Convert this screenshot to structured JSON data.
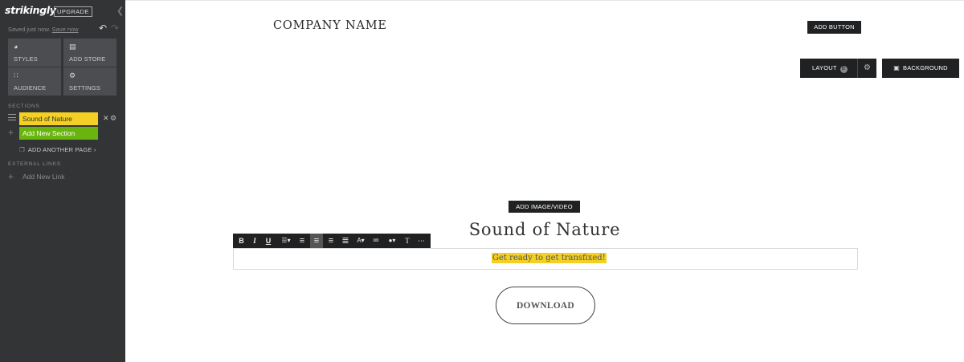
{
  "sidebar": {
    "logo": "strikingly",
    "upgrade": "UPGRADE",
    "saved_text": "Saved just now.",
    "save_now": "Save now",
    "tiles": [
      {
        "label": "STYLES",
        "icon": "palette-icon",
        "glyph": "◕"
      },
      {
        "label": "ADD STORE",
        "icon": "store-bag-icon",
        "glyph": "▤"
      },
      {
        "label": "AUDIENCE",
        "icon": "people-icon",
        "glyph": "∷"
      },
      {
        "label": "SETTINGS",
        "icon": "gear-icon",
        "glyph": "⚙"
      }
    ],
    "sections_title": "SECTIONS",
    "section_item": "Sound of Nature",
    "add_section": "Add New Section",
    "add_page": "ADD ANOTHER PAGE",
    "external_title": "EXTERNAL LINKS",
    "add_link": "Add New Link"
  },
  "main": {
    "company_name": "COMPANY NAME",
    "add_button": "ADD BUTTON",
    "layout": "LAYOUT",
    "layout_badge": "B",
    "background": "BACKGROUND",
    "add_image": "ADD IMAGE/VIDEO",
    "title": "Sound of Nature",
    "subtitle": "Get ready to get transfixed!",
    "download": "DOWNLOAD",
    "toolbar": [
      {
        "name": "bold-icon",
        "glyph": "B"
      },
      {
        "name": "italic-icon",
        "glyph": "I"
      },
      {
        "name": "underline-icon",
        "glyph": "U"
      },
      {
        "name": "list-icon",
        "glyph": "☰▾"
      },
      {
        "name": "align-left-icon",
        "glyph": "≡"
      },
      {
        "name": "align-center-icon",
        "glyph": "≡"
      },
      {
        "name": "align-right-icon",
        "glyph": "≡"
      },
      {
        "name": "align-justify-icon",
        "glyph": "≣"
      },
      {
        "name": "font-size-icon",
        "glyph": "A▾"
      },
      {
        "name": "link-icon",
        "glyph": "∞"
      },
      {
        "name": "color-icon",
        "glyph": "●▾"
      },
      {
        "name": "clear-format-icon",
        "glyph": "T"
      },
      {
        "name": "more-icon",
        "glyph": "⋯"
      }
    ]
  },
  "colors": {
    "sidebar_bg": "#333436",
    "tile_bg": "#4c4d50",
    "section_active": "#f3d023",
    "add_section": "#69b40e",
    "dark_button": "#202123"
  }
}
